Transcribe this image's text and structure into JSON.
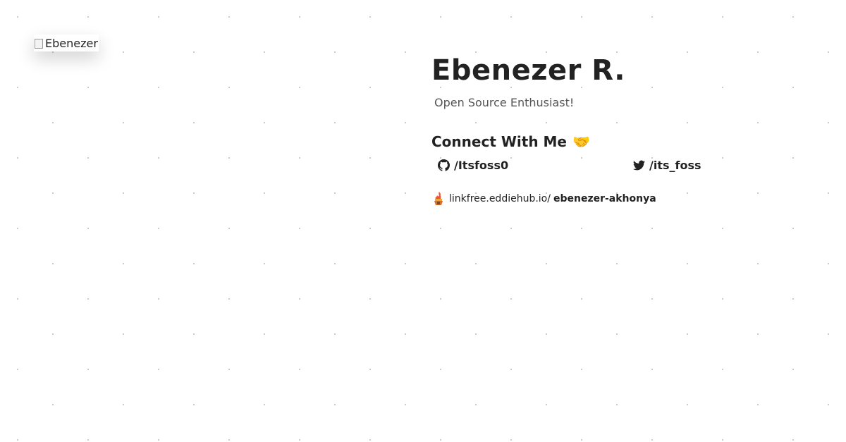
{
  "avatar": {
    "alt_text": "Ebenezer"
  },
  "profile": {
    "name": "Ebenezer R.",
    "tagline": "Open Source Enthusiast!"
  },
  "connect": {
    "heading": "Connect With Me",
    "heading_emoji": "🤝",
    "links": [
      {
        "icon": "github-icon",
        "label": "/Itsfoss0"
      },
      {
        "icon": "twitter-icon",
        "label": "/its_foss"
      }
    ]
  },
  "linkfree": {
    "icon": "linkfree-logo-icon",
    "domain": "linkfree.eddiehub.io/",
    "username": "ebenezer-akhonya"
  },
  "colors": {
    "text": "#222222",
    "muted": "#555555",
    "dot_grid": "#c9c9c9",
    "emoji_accent": "#e8a31a"
  }
}
